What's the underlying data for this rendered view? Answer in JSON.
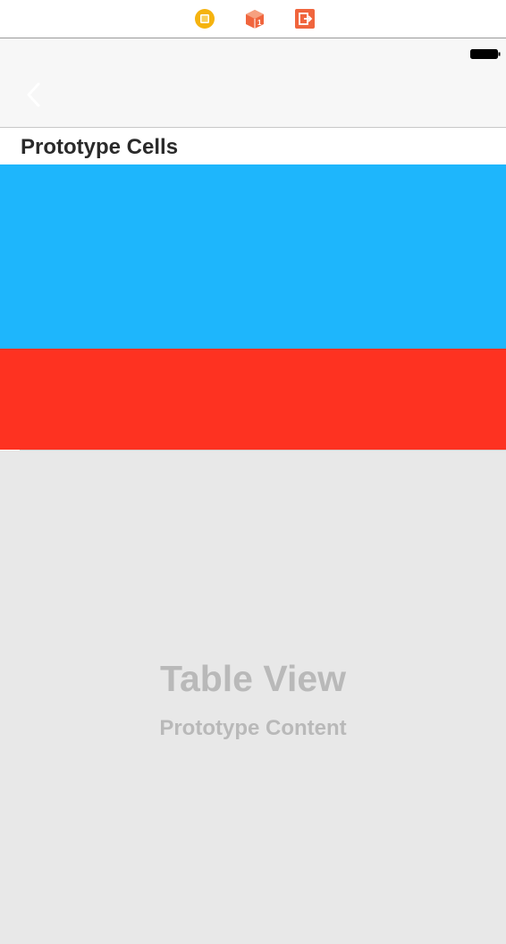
{
  "scene_dock": {
    "icons": [
      "view-controller-icon",
      "first-responder-icon",
      "exit-icon"
    ],
    "colors": {
      "view_controller": "#f5b30f",
      "first_responder": "#f0653d",
      "exit": "#f0653d"
    }
  },
  "status_bar": {
    "battery_icon": "battery-icon"
  },
  "nav_bar": {
    "back_icon": "chevron-left-icon"
  },
  "table": {
    "section_header": "Prototype Cells",
    "cells": [
      {
        "color": "#1eb6fc"
      },
      {
        "color": "#fe3221"
      }
    ],
    "placeholder_title": "Table View",
    "placeholder_subtitle": "Prototype Content",
    "background": "#e8e8e8"
  }
}
